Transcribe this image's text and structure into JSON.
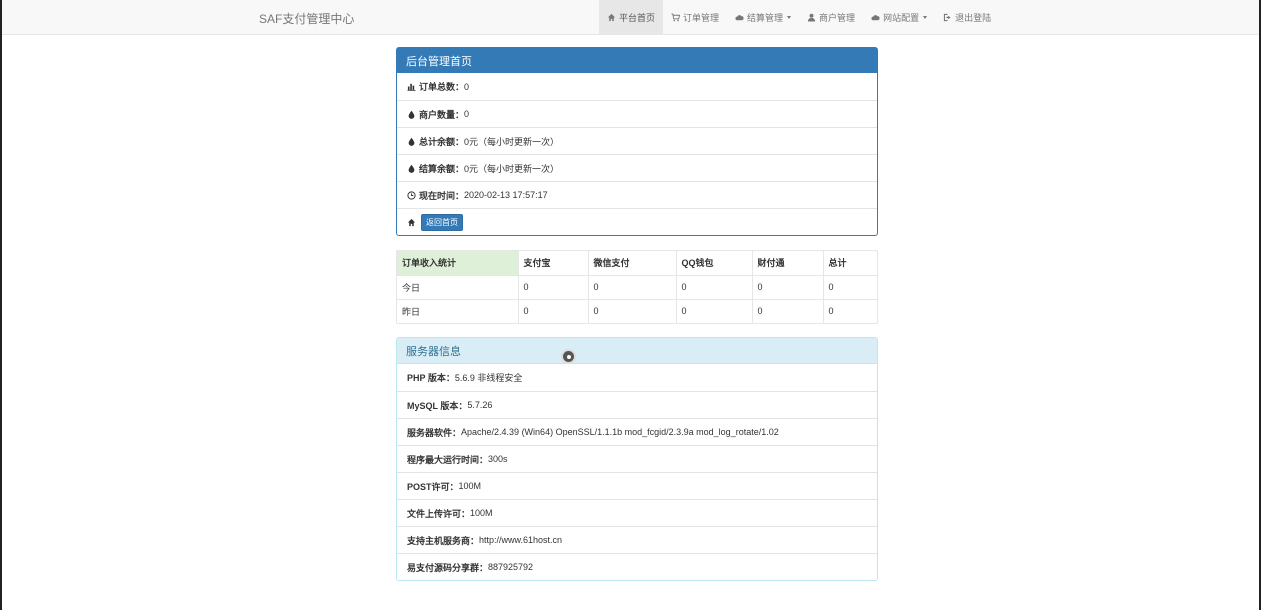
{
  "navbar": {
    "brand": "SAF支付管理中心",
    "items": [
      {
        "label": "平台首页",
        "icon": "home-icon"
      },
      {
        "label": "订单管理",
        "icon": "cart-icon"
      },
      {
        "label": "结算管理",
        "icon": "cloud-icon"
      },
      {
        "label": "商户管理",
        "icon": "user-icon"
      },
      {
        "label": "网站配置",
        "icon": "cloud-icon"
      },
      {
        "label": "退出登陆",
        "icon": "logout-icon"
      }
    ]
  },
  "admin_panel": {
    "title": "后台管理首页",
    "rows": [
      {
        "label": "订单总数：",
        "value": "0"
      },
      {
        "label": "商户数量：",
        "value": "0"
      },
      {
        "label": "总计余额：",
        "value": "0元（每小时更新一次）"
      },
      {
        "label": "结算余额：",
        "value": "0元（每小时更新一次）"
      },
      {
        "label": "现在时间：",
        "value": " 2020-02-13 17:57:17"
      }
    ],
    "home_button": "返回首页"
  },
  "stats": {
    "headers": [
      "订单收入统计",
      "支付宝",
      "微信支付",
      "QQ钱包",
      "财付通",
      "总计"
    ],
    "rows": [
      [
        "今日",
        "0",
        "0",
        "0",
        "0",
        "0"
      ],
      [
        "昨日",
        "0",
        "0",
        "0",
        "0",
        "0"
      ]
    ]
  },
  "server_panel": {
    "title": "服务器信息",
    "rows": [
      {
        "label": "PHP 版本：",
        "value": "5.6.9 非线程安全"
      },
      {
        "label": "MySQL 版本：",
        "value": "5.7.26"
      },
      {
        "label": "服务器软件：",
        "value": "Apache/2.4.39 (Win64) OpenSSL/1.1.1b mod_fcgid/2.3.9a mod_log_rotate/1.02"
      },
      {
        "label": "程序最大运行时间：",
        "value": "300s"
      },
      {
        "label": "POST许可：",
        "value": "100M"
      },
      {
        "label": "文件上传许可：",
        "value": "100M"
      },
      {
        "label": "支持主机服务商：",
        "value": "http://www.61host.cn"
      },
      {
        "label": "易支付源码分享群：",
        "value": "887925792"
      }
    ]
  }
}
